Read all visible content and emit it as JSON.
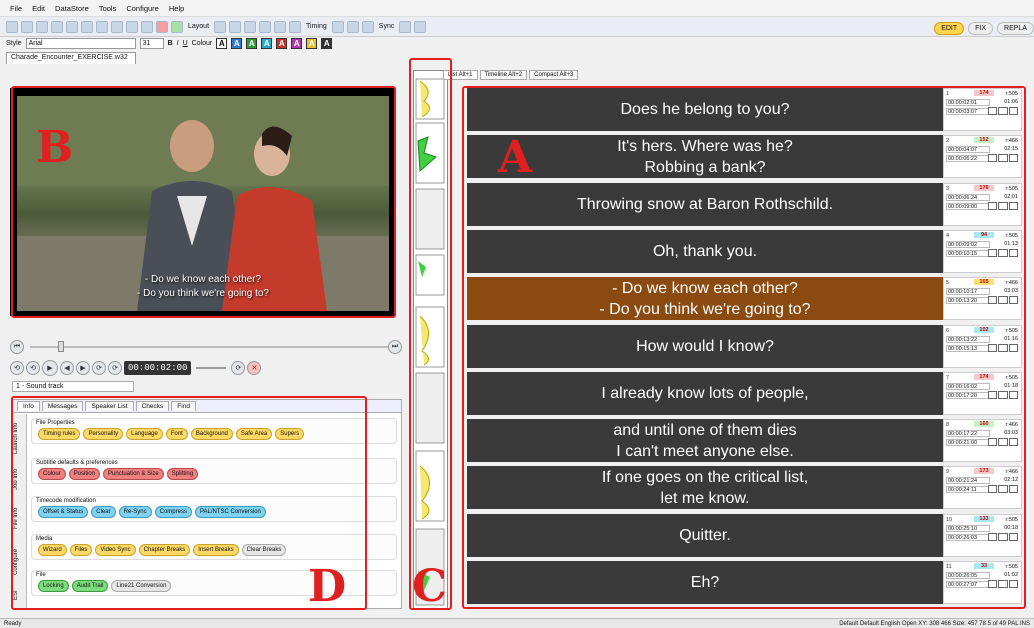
{
  "menu": [
    "File",
    "Edit",
    "DataStore",
    "Tools",
    "Configure",
    "Help"
  ],
  "toolbar": {
    "layout_label": "Layout",
    "timing_label": "Timing",
    "sync_label": "Sync"
  },
  "stylebar": {
    "style_label": "Style",
    "style_value": "Arial",
    "size_value": "31",
    "bold": "B",
    "italic": "I",
    "underline": "U",
    "colour_label": "Colour",
    "colour_glyph": "A"
  },
  "modes": [
    "EDIT",
    "FIX",
    "REPLA"
  ],
  "file_tab": "Charade_Encounter_EXERCISE.w32",
  "video": {
    "sub_line1": "- Do we know each other?",
    "sub_line2": "- Do you think we're going to?"
  },
  "transport": {
    "timecode": "00:00:02:00",
    "sound_track": "1 - Sound track"
  },
  "info": {
    "tabs": [
      "Info",
      "Messages",
      "Speaker List",
      "Checks",
      "Find"
    ],
    "vtabs": [
      "Launch Info",
      "Job Info",
      "File Info",
      "Configure",
      "ESI"
    ],
    "sections": [
      {
        "title": "File Properties",
        "pills": [
          [
            "Timing rules",
            "yellow"
          ],
          [
            "Personality",
            "yellow"
          ],
          [
            "Language",
            "yellow"
          ],
          [
            "Font",
            "yellow"
          ],
          [
            "Background",
            "yellow"
          ],
          [
            "Safe Area",
            "yellow"
          ],
          [
            "Supers",
            "yellow"
          ]
        ]
      },
      {
        "title": "Subtitle defaults & preferences",
        "pills": [
          [
            "Colour",
            "red"
          ],
          [
            "Position",
            "red"
          ],
          [
            "Punctuation & Size",
            "red"
          ],
          [
            "Splitting",
            "red"
          ]
        ]
      },
      {
        "title": "Timecode modification",
        "pills": [
          [
            "Offset & Status",
            "blue"
          ],
          [
            "Clear",
            "blue"
          ],
          [
            "Re-Sync",
            "blue"
          ],
          [
            "Compress",
            "blue"
          ],
          [
            "PAL/NTSC Conversion",
            "blue"
          ]
        ]
      },
      {
        "title": "Media",
        "pills": [
          [
            "Wizard",
            "yellow"
          ],
          [
            "Files",
            "yellow"
          ],
          [
            "Video Sync",
            "yellow"
          ],
          [
            "Chapter Breaks",
            "yellow"
          ],
          [
            "Insert Breaks",
            "yellow"
          ],
          [
            "Clear Breaks",
            "grey"
          ]
        ]
      },
      {
        "title": "File",
        "pills": [
          [
            "Locking",
            "green"
          ],
          [
            "Audit Trail",
            "green"
          ],
          [
            "Line21 Conversion",
            "grey"
          ]
        ]
      }
    ]
  },
  "list_tabs": [
    "List Alt+1",
    "Timeline Alt+2",
    "Compact Alt+3"
  ],
  "subtitles": [
    {
      "num": "1",
      "lines": [
        "Does he belong to you?"
      ],
      "cps": "174",
      "chars": "r:505",
      "tin": "00:00:02:01",
      "tout": "00:00:03:07",
      "dur": "01:06",
      "cpscolor": "#f7c8c8"
    },
    {
      "num": "2",
      "lines": [
        "It's hers. Where was he?",
        "Robbing a bank?"
      ],
      "cps": "152",
      "chars": "r:466",
      "tin": "00:00:04:07",
      "tout": "00:00:06:22",
      "dur": "02:15",
      "cpscolor": "#c8f0c8"
    },
    {
      "num": "3",
      "lines": [
        "Throwing snow at Baron Rothschild."
      ],
      "cps": "176",
      "chars": "r:505",
      "tin": "00:00:06:24",
      "tout": "00:00:09:00",
      "dur": "02:01",
      "cpscolor": "#f7c8c8"
    },
    {
      "num": "4",
      "lines": [
        "Oh, thank you."
      ],
      "cps": "94",
      "chars": "r:505",
      "tin": "00:00:09:02",
      "tout": "00:00:10:15",
      "dur": "01:13",
      "cpscolor": "#a8e8f0"
    },
    {
      "num": "5",
      "lines": [
        "- Do we know each other?",
        "- Do you think we're going to?"
      ],
      "cps": "165",
      "chars": "r:466",
      "tin": "00:00:10:17",
      "tout": "00:00:13:20",
      "dur": "03:03",
      "cpscolor": "#ffe070",
      "active": true
    },
    {
      "num": "6",
      "lines": [
        "How would I know?"
      ],
      "cps": "102",
      "chars": "r:505",
      "tin": "00:00:13:22",
      "tout": "00:00:15:13",
      "dur": "01:16",
      "cpscolor": "#a8e8f0"
    },
    {
      "num": "7",
      "lines": [
        "I already know lots of people,"
      ],
      "cps": "174",
      "chars": "r:505",
      "tin": "00:00:16:02",
      "tout": "00:00:17:20",
      "dur": "01:18",
      "cpscolor": "#f7c8c8"
    },
    {
      "num": "8",
      "lines": [
        "and until one of them dies",
        "I can't meet anyone else."
      ],
      "cps": "160",
      "chars": "r:466",
      "tin": "00:00:17:22",
      "tout": "00:00:21:00",
      "dur": "03:03",
      "cpscolor": "#c8f0c8"
    },
    {
      "num": "9",
      "lines": [
        "If one goes on the critical list,",
        "let me know."
      ],
      "cps": "173",
      "chars": "r:466",
      "tin": "00:00:21:24",
      "tout": "00:00:24:11",
      "dur": "02:12",
      "cpscolor": "#f7c8c8"
    },
    {
      "num": "10",
      "lines": [
        "Quitter."
      ],
      "cps": "133",
      "chars": "r:505",
      "tin": "00:00:25:10",
      "tout": "00:00:26:03",
      "dur": "00:18",
      "cpscolor": "#a8e8f0"
    },
    {
      "num": "11",
      "lines": [
        "Eh?"
      ],
      "cps": "33",
      "chars": "r:505",
      "tin": "00:00:26:05",
      "tout": "00:00:27:07",
      "dur": "01:02",
      "cpscolor": "#a8e8f0"
    }
  ],
  "labels": {
    "a": "A",
    "b": "B",
    "c": "C",
    "d": "D"
  },
  "status": {
    "left": "Ready",
    "right": "Default  Default  English  Open  XY: 308 466  Size: 457 78  5 of 49  PAL  INS"
  }
}
